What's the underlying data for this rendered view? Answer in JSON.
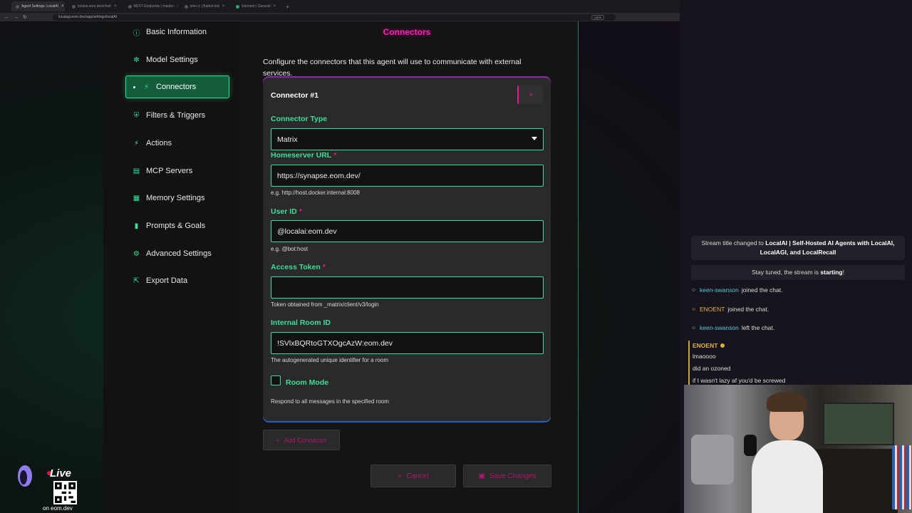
{
  "browser": {
    "tabs": [
      {
        "label": "Agent Settings: LocalAI",
        "active": true
      },
      {
        "label": "localai.eom.dev/chat/",
        "active": false
      },
      {
        "label": "REST Endpoints | maubo",
        "active": false
      },
      {
        "label": "nhe.cc | Baibot bot",
        "active": false
      },
      {
        "label": "Element | General",
        "active": false
      }
    ],
    "url": "localagi.eom.dev/app/settings/localAI",
    "zoom": "100%"
  },
  "sidebar": {
    "items": [
      {
        "label": "Basic Information",
        "icon": "info-icon"
      },
      {
        "label": "Model Settings",
        "icon": "brain-icon"
      },
      {
        "label": "Connectors",
        "icon": "plug-icon",
        "active": true
      },
      {
        "label": "Filters & Triggers",
        "icon": "shield-icon"
      },
      {
        "label": "Actions",
        "icon": "bolt-icon"
      },
      {
        "label": "MCP Servers",
        "icon": "server-icon"
      },
      {
        "label": "Memory Settings",
        "icon": "memory-icon"
      },
      {
        "label": "Prompts & Goals",
        "icon": "comment-icon"
      },
      {
        "label": "Advanced Settings",
        "icon": "cogs-icon"
      },
      {
        "label": "Export Data",
        "icon": "export-icon"
      }
    ]
  },
  "main": {
    "title": "Connectors",
    "description": "Configure the connectors that this agent will use to communicate with external services.",
    "connector": {
      "title": "Connector #1",
      "remove_label": "×",
      "type_label": "Connector Type",
      "type_value": "Matrix",
      "homeserver_label": "Homeserver URL",
      "homeserver_value": "https://synapse.eom.dev/",
      "homeserver_hint": "e.g. http://host.docker.internal:8008",
      "userid_label": "User ID",
      "userid_value": "@localai:eom.dev",
      "userid_hint": "e.g. @bot:host",
      "token_label": "Access Token",
      "token_value": "",
      "token_hint": "Token obtained from _matrix/client/v3/login",
      "room_label": "Internal Room ID",
      "room_value": "!SVlxBQRtoGTXOgcAzW:eom.dev",
      "room_hint": "The autogenerated unique identifier for a room",
      "roommode_label": "Room Mode",
      "roommode_hint": "Respond to all messages in the specified room",
      "required_mark": "*"
    },
    "add_connector_label": "Add Connector",
    "cancel_label": "Cancel",
    "save_label": "Save Changes"
  },
  "live": {
    "label": "Live",
    "url": "on eom.dev"
  },
  "chat": {
    "notice_title_prefix": "Stream title changed to",
    "notice_title": "LocalAI | Self-Hosted AI Agents with LocalAI, LocalAGI, and LocalRecall",
    "notice_stay_prefix": "Stay tuned, the stream is",
    "notice_stay_bold": "starting",
    "notice_stay_suffix": "!",
    "events": [
      {
        "user": "keen-swanson",
        "text": "joined the chat."
      },
      {
        "user": "ENOENT",
        "text": "joined the chat."
      },
      {
        "user": "keen-swanson",
        "text": "left the chat."
      }
    ],
    "author": "ENOENT",
    "messages": [
      "lmaoooo",
      "did an ozoned",
      "if I wasn't lazy af you'd be screwed"
    ]
  },
  "colors": {
    "accent_green": "#3ddf98",
    "accent_pink": "#ff1fb8",
    "card_bg": "#2a2a2a"
  }
}
